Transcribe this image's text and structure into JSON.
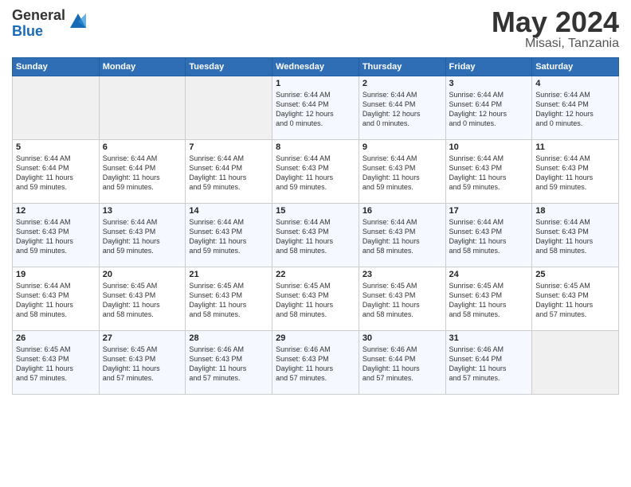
{
  "logo": {
    "general": "General",
    "blue": "Blue"
  },
  "title": "May 2024",
  "location": "Misasi, Tanzania",
  "days_header": [
    "Sunday",
    "Monday",
    "Tuesday",
    "Wednesday",
    "Thursday",
    "Friday",
    "Saturday"
  ],
  "weeks": [
    [
      {
        "day": "",
        "info": ""
      },
      {
        "day": "",
        "info": ""
      },
      {
        "day": "",
        "info": ""
      },
      {
        "day": "1",
        "info": "Sunrise: 6:44 AM\nSunset: 6:44 PM\nDaylight: 12 hours\nand 0 minutes."
      },
      {
        "day": "2",
        "info": "Sunrise: 6:44 AM\nSunset: 6:44 PM\nDaylight: 12 hours\nand 0 minutes."
      },
      {
        "day": "3",
        "info": "Sunrise: 6:44 AM\nSunset: 6:44 PM\nDaylight: 12 hours\nand 0 minutes."
      },
      {
        "day": "4",
        "info": "Sunrise: 6:44 AM\nSunset: 6:44 PM\nDaylight: 12 hours\nand 0 minutes."
      }
    ],
    [
      {
        "day": "5",
        "info": "Sunrise: 6:44 AM\nSunset: 6:44 PM\nDaylight: 11 hours\nand 59 minutes."
      },
      {
        "day": "6",
        "info": "Sunrise: 6:44 AM\nSunset: 6:44 PM\nDaylight: 11 hours\nand 59 minutes."
      },
      {
        "day": "7",
        "info": "Sunrise: 6:44 AM\nSunset: 6:44 PM\nDaylight: 11 hours\nand 59 minutes."
      },
      {
        "day": "8",
        "info": "Sunrise: 6:44 AM\nSunset: 6:43 PM\nDaylight: 11 hours\nand 59 minutes."
      },
      {
        "day": "9",
        "info": "Sunrise: 6:44 AM\nSunset: 6:43 PM\nDaylight: 11 hours\nand 59 minutes."
      },
      {
        "day": "10",
        "info": "Sunrise: 6:44 AM\nSunset: 6:43 PM\nDaylight: 11 hours\nand 59 minutes."
      },
      {
        "day": "11",
        "info": "Sunrise: 6:44 AM\nSunset: 6:43 PM\nDaylight: 11 hours\nand 59 minutes."
      }
    ],
    [
      {
        "day": "12",
        "info": "Sunrise: 6:44 AM\nSunset: 6:43 PM\nDaylight: 11 hours\nand 59 minutes."
      },
      {
        "day": "13",
        "info": "Sunrise: 6:44 AM\nSunset: 6:43 PM\nDaylight: 11 hours\nand 59 minutes."
      },
      {
        "day": "14",
        "info": "Sunrise: 6:44 AM\nSunset: 6:43 PM\nDaylight: 11 hours\nand 59 minutes."
      },
      {
        "day": "15",
        "info": "Sunrise: 6:44 AM\nSunset: 6:43 PM\nDaylight: 11 hours\nand 58 minutes."
      },
      {
        "day": "16",
        "info": "Sunrise: 6:44 AM\nSunset: 6:43 PM\nDaylight: 11 hours\nand 58 minutes."
      },
      {
        "day": "17",
        "info": "Sunrise: 6:44 AM\nSunset: 6:43 PM\nDaylight: 11 hours\nand 58 minutes."
      },
      {
        "day": "18",
        "info": "Sunrise: 6:44 AM\nSunset: 6:43 PM\nDaylight: 11 hours\nand 58 minutes."
      }
    ],
    [
      {
        "day": "19",
        "info": "Sunrise: 6:44 AM\nSunset: 6:43 PM\nDaylight: 11 hours\nand 58 minutes."
      },
      {
        "day": "20",
        "info": "Sunrise: 6:45 AM\nSunset: 6:43 PM\nDaylight: 11 hours\nand 58 minutes."
      },
      {
        "day": "21",
        "info": "Sunrise: 6:45 AM\nSunset: 6:43 PM\nDaylight: 11 hours\nand 58 minutes."
      },
      {
        "day": "22",
        "info": "Sunrise: 6:45 AM\nSunset: 6:43 PM\nDaylight: 11 hours\nand 58 minutes."
      },
      {
        "day": "23",
        "info": "Sunrise: 6:45 AM\nSunset: 6:43 PM\nDaylight: 11 hours\nand 58 minutes."
      },
      {
        "day": "24",
        "info": "Sunrise: 6:45 AM\nSunset: 6:43 PM\nDaylight: 11 hours\nand 58 minutes."
      },
      {
        "day": "25",
        "info": "Sunrise: 6:45 AM\nSunset: 6:43 PM\nDaylight: 11 hours\nand 57 minutes."
      }
    ],
    [
      {
        "day": "26",
        "info": "Sunrise: 6:45 AM\nSunset: 6:43 PM\nDaylight: 11 hours\nand 57 minutes."
      },
      {
        "day": "27",
        "info": "Sunrise: 6:45 AM\nSunset: 6:43 PM\nDaylight: 11 hours\nand 57 minutes."
      },
      {
        "day": "28",
        "info": "Sunrise: 6:46 AM\nSunset: 6:43 PM\nDaylight: 11 hours\nand 57 minutes."
      },
      {
        "day": "29",
        "info": "Sunrise: 6:46 AM\nSunset: 6:43 PM\nDaylight: 11 hours\nand 57 minutes."
      },
      {
        "day": "30",
        "info": "Sunrise: 6:46 AM\nSunset: 6:44 PM\nDaylight: 11 hours\nand 57 minutes."
      },
      {
        "day": "31",
        "info": "Sunrise: 6:46 AM\nSunset: 6:44 PM\nDaylight: 11 hours\nand 57 minutes."
      },
      {
        "day": "",
        "info": ""
      }
    ]
  ]
}
